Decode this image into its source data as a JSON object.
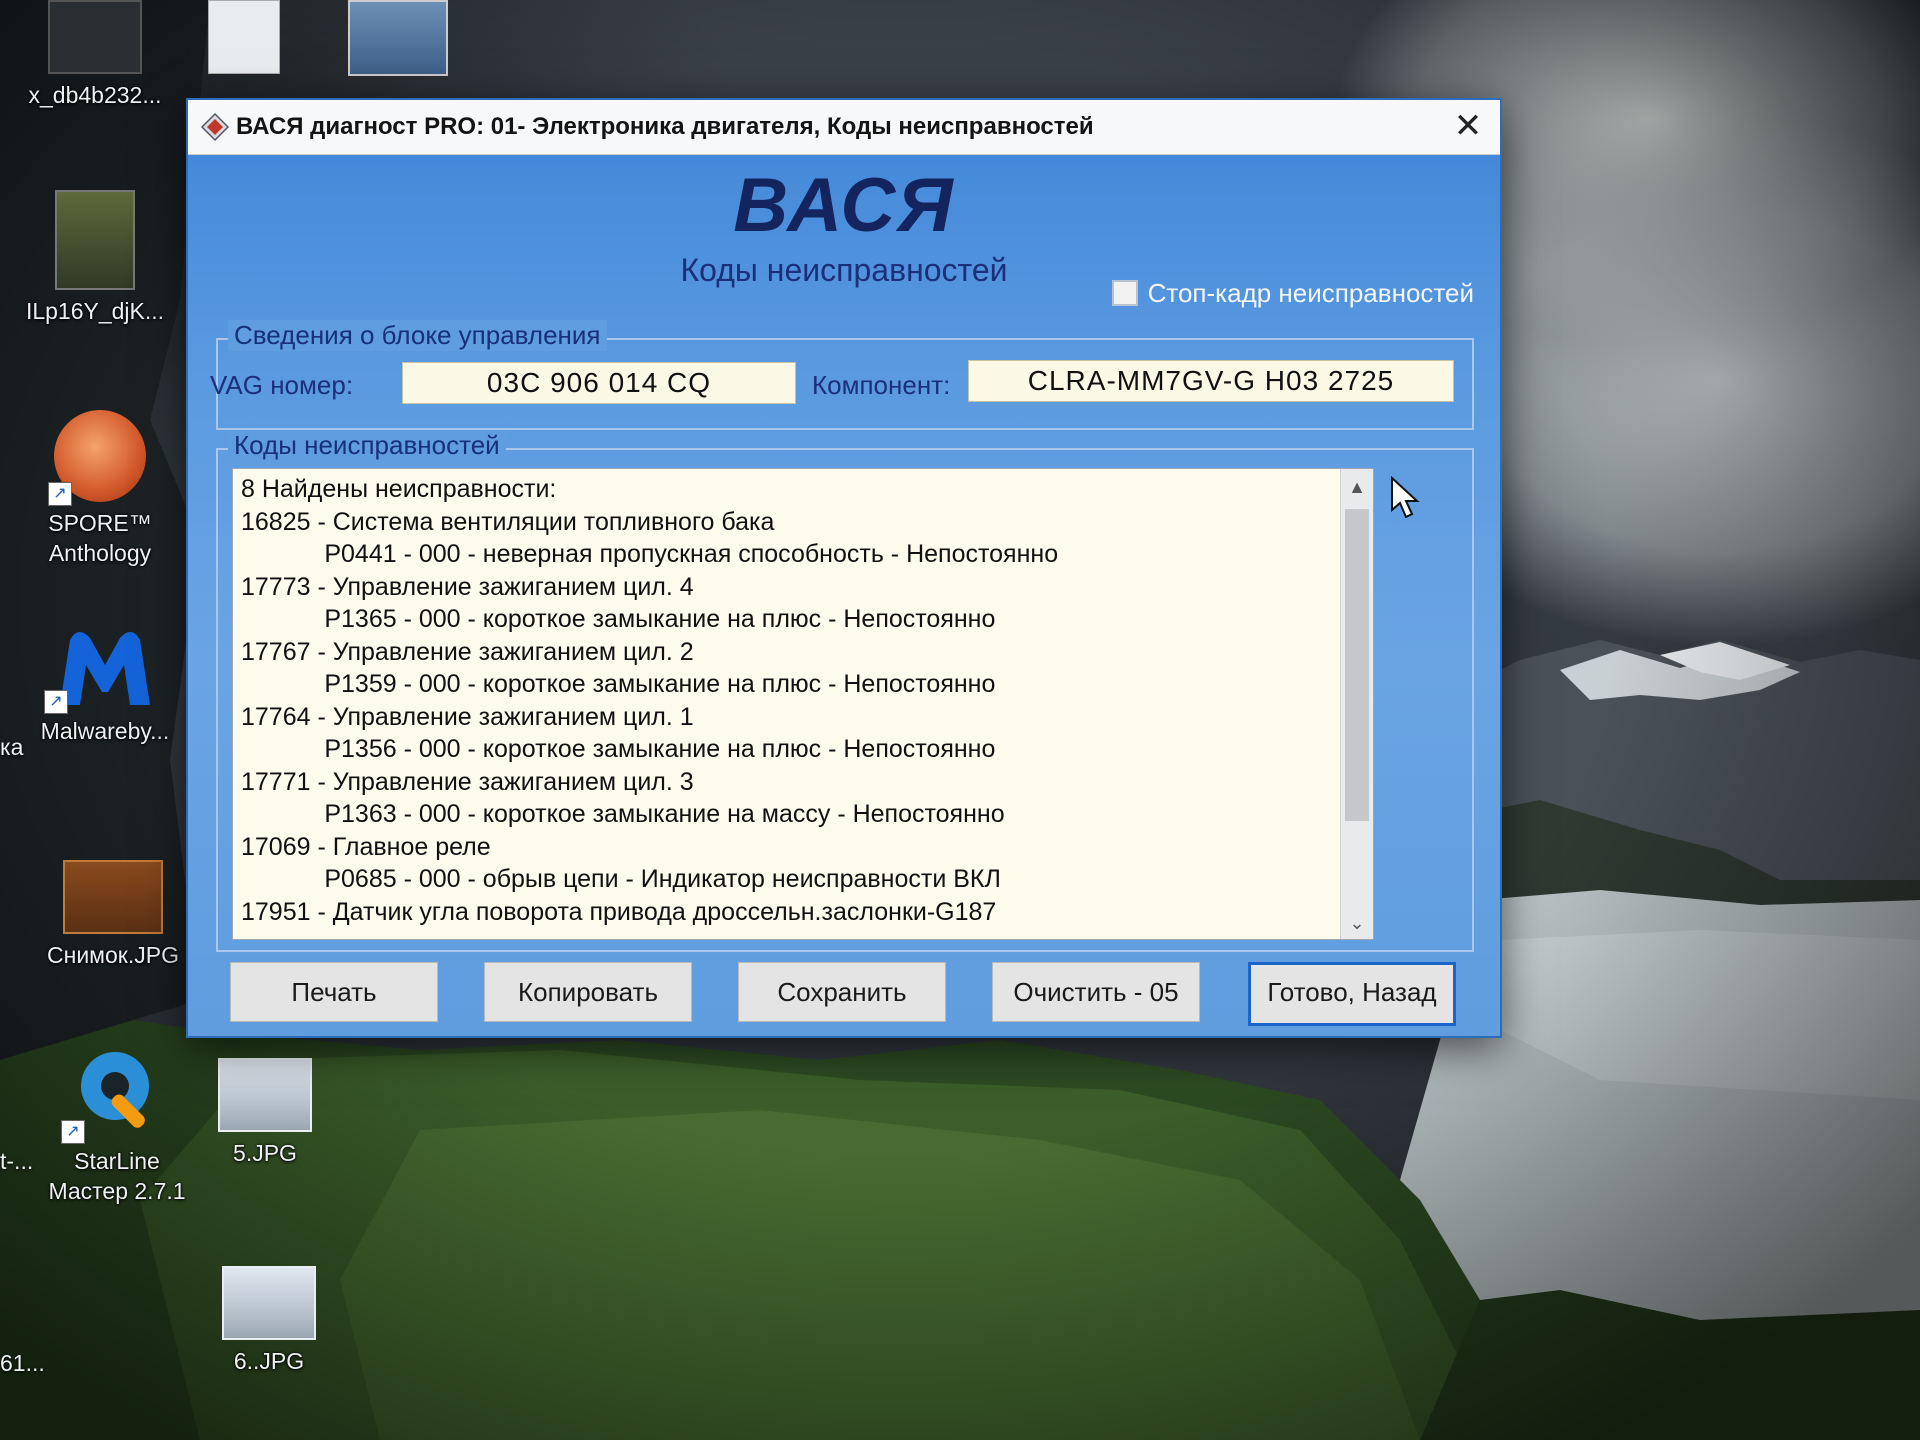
{
  "desktop": {
    "icons": [
      {
        "label": "x_db4b232..."
      },
      {
        "label": "ILp16Y_djK..."
      },
      {
        "label": "SPORE™\nAnthology"
      },
      {
        "label": "Malwareby..."
      },
      {
        "label": "Снимок.JPG"
      },
      {
        "label": "StarLine\nМастер 2.7.1"
      },
      {
        "label": "5.JPG"
      },
      {
        "label": "6..JPG"
      }
    ],
    "edge_labels": [
      "ка",
      "t-...",
      "61..."
    ]
  },
  "window": {
    "title": "ВАСЯ диагност PRO: 01- Электроника двигателя,  Коды неисправностей",
    "close_symbol": "✕",
    "brand": "ВАСЯ",
    "subtitle": "Коды неисправностей",
    "freeze_frame_label": "Стоп-кадр неисправностей",
    "freeze_frame_checked": false,
    "ecu_group": {
      "title": "Сведения о блоке управления",
      "vag_label": "VAG номер:",
      "vag_value": "03C 906 014 CQ",
      "component_label": "Компонент:",
      "component_value": "CLRA-MM7GV-G  H03 2725"
    },
    "codes_group": {
      "title": "Коды неисправностей",
      "lines": [
        "8 Найдены неисправности:",
        "16825 - Система вентиляции топливного бака",
        "            P0441 - 000 - неверная пропускная способность - Непостоянно",
        "17773 - Управление зажиганием цил. 4",
        "            P1365 - 000 - короткое замыкание на плюс - Непостоянно",
        "17767 - Управление зажиганием цил. 2",
        "            P1359 - 000 - короткое замыкание на плюс - Непостоянно",
        "17764 - Управление зажиганием цил. 1",
        "            P1356 - 000 - короткое замыкание на плюс - Непостоянно",
        "17771 - Управление зажиганием цил. 3",
        "            P1363 - 000 - короткое замыкание на массу - Непостоянно",
        "17069 - Главное реле",
        "            P0685 - 000 - обрыв цепи - Индикатор неисправности ВКЛ",
        "17951 - Датчик угла поворота привода дроссельн.заслонки-G187"
      ],
      "scroll_up": "▲",
      "scroll_down": "⌄"
    },
    "buttons": {
      "print": "Печать",
      "copy": "Копировать",
      "save": "Сохранить",
      "clear": "Очистить - 05",
      "done": "Готово, Назад"
    }
  },
  "colors": {
    "window_accent": "#3f86d8",
    "brand_text": "#13245e",
    "field_bg": "#fbf8e6",
    "default_button_border": "#1c64c8"
  }
}
